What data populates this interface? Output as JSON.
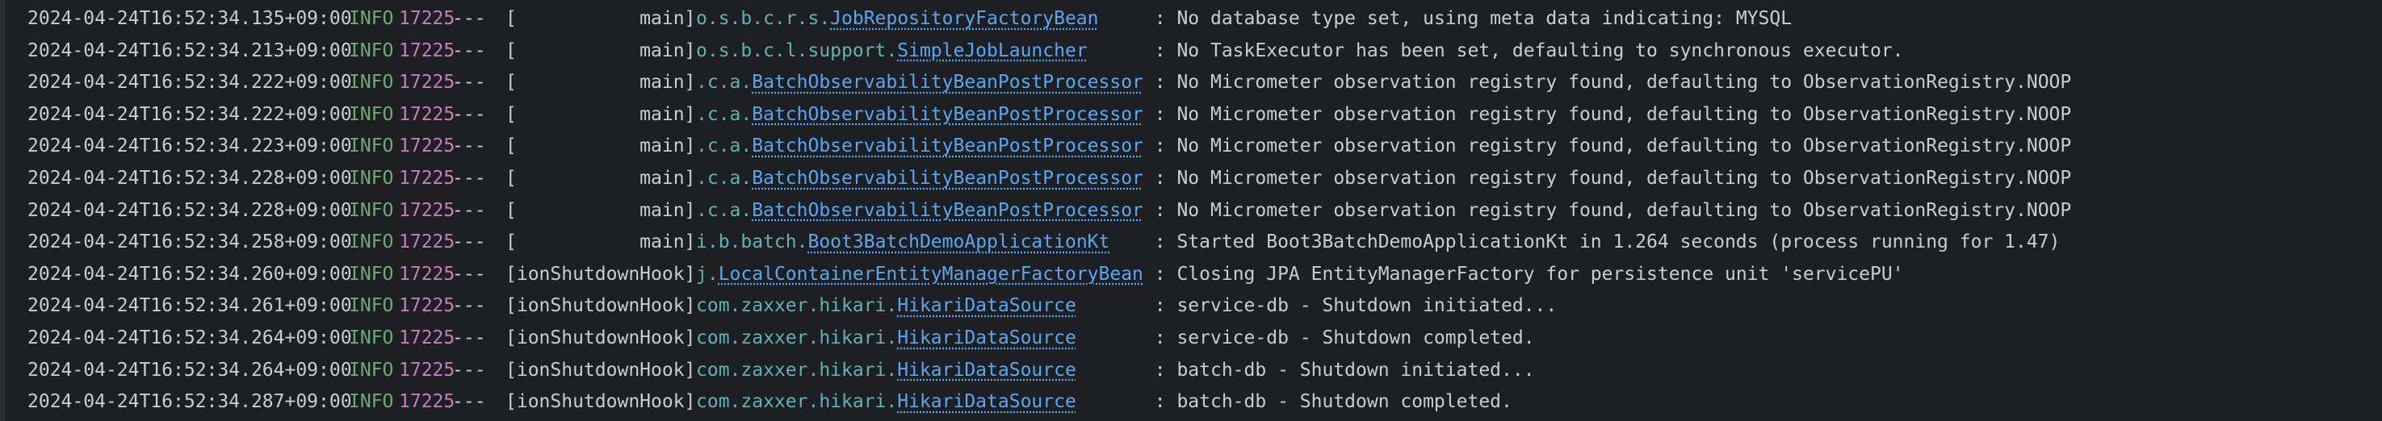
{
  "console": {
    "lines": [
      {
        "timestamp": "2024-04-24T16:52:34.135+09:00",
        "level": "INFO",
        "pid": "17225",
        "sep": "---",
        "thread": "[           main]",
        "logger_pkg": "o.s.b.c.r.s.",
        "logger_cls": "JobRepositoryFactoryBean",
        "logger_pad": "     ",
        "message": ": No database type set, using meta data indicating: MYSQL"
      },
      {
        "timestamp": "2024-04-24T16:52:34.213+09:00",
        "level": "INFO",
        "pid": "17225",
        "sep": "---",
        "thread": "[           main]",
        "logger_pkg": "o.s.b.c.l.support.",
        "logger_cls": "SimpleJobLauncher",
        "logger_pad": "      ",
        "message": ": No TaskExecutor has been set, defaulting to synchronous executor."
      },
      {
        "timestamp": "2024-04-24T16:52:34.222+09:00",
        "level": "INFO",
        "pid": "17225",
        "sep": "---",
        "thread": "[           main]",
        "logger_pkg": ".c.a.",
        "logger_cls": "BatchObservabilityBeanPostProcessor",
        "logger_pad": " ",
        "message": ": No Micrometer observation registry found, defaulting to ObservationRegistry.NOOP"
      },
      {
        "timestamp": "2024-04-24T16:52:34.222+09:00",
        "level": "INFO",
        "pid": "17225",
        "sep": "---",
        "thread": "[           main]",
        "logger_pkg": ".c.a.",
        "logger_cls": "BatchObservabilityBeanPostProcessor",
        "logger_pad": " ",
        "message": ": No Micrometer observation registry found, defaulting to ObservationRegistry.NOOP"
      },
      {
        "timestamp": "2024-04-24T16:52:34.223+09:00",
        "level": "INFO",
        "pid": "17225",
        "sep": "---",
        "thread": "[           main]",
        "logger_pkg": ".c.a.",
        "logger_cls": "BatchObservabilityBeanPostProcessor",
        "logger_pad": " ",
        "message": ": No Micrometer observation registry found, defaulting to ObservationRegistry.NOOP"
      },
      {
        "timestamp": "2024-04-24T16:52:34.228+09:00",
        "level": "INFO",
        "pid": "17225",
        "sep": "---",
        "thread": "[           main]",
        "logger_pkg": ".c.a.",
        "logger_cls": "BatchObservabilityBeanPostProcessor",
        "logger_pad": " ",
        "message": ": No Micrometer observation registry found, defaulting to ObservationRegistry.NOOP"
      },
      {
        "timestamp": "2024-04-24T16:52:34.228+09:00",
        "level": "INFO",
        "pid": "17225",
        "sep": "---",
        "thread": "[           main]",
        "logger_pkg": ".c.a.",
        "logger_cls": "BatchObservabilityBeanPostProcessor",
        "logger_pad": " ",
        "message": ": No Micrometer observation registry found, defaulting to ObservationRegistry.NOOP"
      },
      {
        "timestamp": "2024-04-24T16:52:34.258+09:00",
        "level": "INFO",
        "pid": "17225",
        "sep": "---",
        "thread": "[           main]",
        "logger_pkg": "i.b.batch.",
        "logger_cls": "Boot3BatchDemoApplicationKt",
        "logger_pad": "    ",
        "message": ": Started Boot3BatchDemoApplicationKt in 1.264 seconds (process running for 1.47)"
      },
      {
        "timestamp": "2024-04-24T16:52:34.260+09:00",
        "level": "INFO",
        "pid": "17225",
        "sep": "---",
        "thread": "[ionShutdownHook]",
        "logger_pkg": "j.",
        "logger_cls": "LocalContainerEntityManagerFactoryBean",
        "logger_pad": " ",
        "message": ": Closing JPA EntityManagerFactory for persistence unit 'servicePU'"
      },
      {
        "timestamp": "2024-04-24T16:52:34.261+09:00",
        "level": "INFO",
        "pid": "17225",
        "sep": "---",
        "thread": "[ionShutdownHook]",
        "logger_pkg": "com.zaxxer.hikari.",
        "logger_cls": "HikariDataSource",
        "logger_pad": "       ",
        "message": ": service-db - Shutdown initiated..."
      },
      {
        "timestamp": "2024-04-24T16:52:34.264+09:00",
        "level": "INFO",
        "pid": "17225",
        "sep": "---",
        "thread": "[ionShutdownHook]",
        "logger_pkg": "com.zaxxer.hikari.",
        "logger_cls": "HikariDataSource",
        "logger_pad": "       ",
        "message": ": service-db - Shutdown completed."
      },
      {
        "timestamp": "2024-04-24T16:52:34.264+09:00",
        "level": "INFO",
        "pid": "17225",
        "sep": "---",
        "thread": "[ionShutdownHook]",
        "logger_pkg": "com.zaxxer.hikari.",
        "logger_cls": "HikariDataSource",
        "logger_pad": "       ",
        "message": ": batch-db - Shutdown initiated..."
      },
      {
        "timestamp": "2024-04-24T16:52:34.287+09:00",
        "level": "INFO",
        "pid": "17225",
        "sep": "---",
        "thread": "[ionShutdownHook]",
        "logger_pkg": "com.zaxxer.hikari.",
        "logger_cls": "HikariDataSource",
        "logger_pad": "       ",
        "message": ": batch-db - Shutdown completed."
      }
    ]
  },
  "colors": {
    "background": "#1e1f22",
    "text": "#c9ccd1",
    "level_info": "#6aab73",
    "pid": "#c77dbb",
    "logger_pkg": "#5fb3b3",
    "logger_class": "#56a8f5"
  }
}
